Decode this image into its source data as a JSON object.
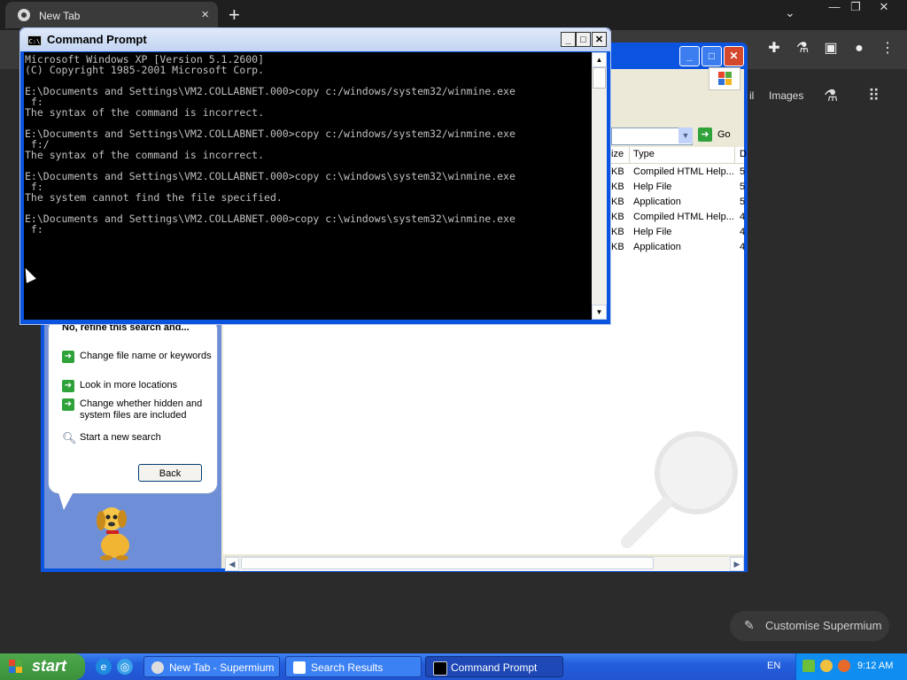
{
  "browser": {
    "tab_title": "New Tab",
    "tab_close": "×",
    "new_tab": "+",
    "tab_dropdown": "⌄",
    "window_minimize": "—",
    "window_restore": "❐",
    "window_close": "✕",
    "ntp_gmail": "il",
    "ntp_images": "Images",
    "customise_label": "Customise Supermium"
  },
  "explorer": {
    "title": "Search Results",
    "go_label": "Go",
    "columns": [
      "ize",
      "Type",
      "D"
    ],
    "rows": [
      {
        "size": "KB",
        "type": "Compiled HTML Help...",
        "date": "5"
      },
      {
        "size": "KB",
        "type": "Help File",
        "date": "5"
      },
      {
        "size": "KB",
        "type": "Application",
        "date": "5"
      },
      {
        "size": "KB",
        "type": "Compiled HTML Help...",
        "date": "4"
      },
      {
        "size": "KB",
        "type": "Help File",
        "date": "4"
      },
      {
        "size": "KB",
        "type": "Application",
        "date": "4"
      }
    ]
  },
  "companion": {
    "heading": "No, refine this search and...",
    "options": [
      "Change file name or keywords",
      "Look in more locations",
      "Change whether hidden and system files are included"
    ],
    "new_search": "Start a new search",
    "back_label": "Back"
  },
  "cmd": {
    "title": "Command Prompt",
    "icon_text": "C:\\",
    "lines": [
      "Microsoft Windows XP [Version 5.1.2600]",
      "(C) Copyright 1985-2001 Microsoft Corp.",
      "",
      "E:\\Documents and Settings\\VM2.COLLABNET.000>copy c:/windows/system32/winmine.exe",
      " f:",
      "The syntax of the command is incorrect.",
      "",
      "E:\\Documents and Settings\\VM2.COLLABNET.000>copy c:/windows/system32/winmine.exe",
      " f:/",
      "The syntax of the command is incorrect.",
      "",
      "E:\\Documents and Settings\\VM2.COLLABNET.000>copy c:\\windows\\system32\\winmine.exe",
      " f:",
      "The system cannot find the file specified.",
      "",
      "E:\\Documents and Settings\\VM2.COLLABNET.000>copy c:\\windows\\system32\\winmine.exe",
      " f:"
    ]
  },
  "taskbar": {
    "start_label": "start",
    "tasks": [
      {
        "label": "New Tab - Supermium",
        "active": false
      },
      {
        "label": "Search Results",
        "active": false
      },
      {
        "label": "Command Prompt",
        "active": true
      }
    ],
    "language": "EN",
    "clock": "9:12 AM"
  },
  "colors": {
    "xp_title_blue": "#0a54e0",
    "taskbar_blue": "#245edb",
    "start_green": "#3a913a",
    "console_text": "#c0c0c0"
  }
}
